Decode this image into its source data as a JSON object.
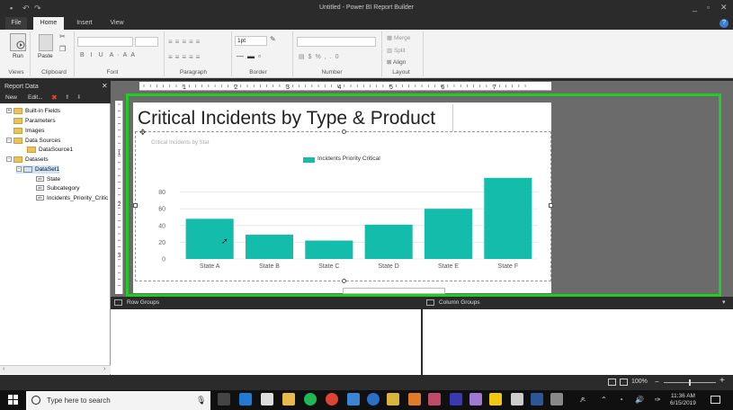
{
  "window": {
    "title": "Untitled - Power BI Report Builder"
  },
  "tabs": [
    {
      "label": "File"
    },
    {
      "label": "Home"
    },
    {
      "label": "Insert"
    },
    {
      "label": "View"
    }
  ],
  "ribbon": {
    "run_label": "Run",
    "paste_label": "Paste",
    "border_size": "1pt",
    "merge_label": "Merge",
    "split_label": "Split",
    "align_label": "Align",
    "groups": {
      "views": "Views",
      "clipboard": "Clipboard",
      "font": "Font",
      "paragraph": "Paragraph",
      "border": "Border",
      "number": "Number",
      "layout": "Layout"
    }
  },
  "report_data": {
    "title": "Report Data",
    "new_label": "New",
    "edit_label": "Edit...",
    "tree": {
      "builtin_fields": "Built-in Fields",
      "parameters": "Parameters",
      "images": "Images",
      "data_sources": "Data Sources",
      "datasource1": "DataSource1",
      "datasets": "Datasets",
      "dataset1": "DataSet1",
      "field_state": "State",
      "field_subcategory": "Subcategory",
      "field_incidents": "Incidents_Priority_Critic"
    }
  },
  "report": {
    "title": "Critical Incidents by Type & Product",
    "chart_subtitle": "Critical Incidents by Stat"
  },
  "ruler_numbers": [
    "1",
    "2",
    "3",
    "4",
    "5",
    "6",
    "7"
  ],
  "ruler_v_numbers": [
    "1",
    "2",
    "3"
  ],
  "chart_data": {
    "type": "bar",
    "categories": [
      "State A",
      "State B",
      "State C",
      "State D",
      "State E",
      "State F"
    ],
    "series": [
      {
        "name": "Incidents Priority Critical",
        "values": [
          48,
          29,
          22,
          41,
          60,
          97
        ],
        "color": "#13bcab"
      }
    ],
    "yticks": [
      0,
      20,
      40,
      60,
      80
    ],
    "ylim": [
      0,
      100
    ],
    "grid": true,
    "legend": "top-center"
  },
  "groups": {
    "row_groups": "Row Groups",
    "column_groups": "Column Groups"
  },
  "status": {
    "zoom": "100%"
  },
  "taskbar": {
    "search_placeholder": "Type here to search",
    "time": "11:36 AM",
    "date": "6/15/2019"
  },
  "colors": {
    "accent_green": "#22cc22",
    "bar": "#13bcab",
    "chrome": "#2b2b2b"
  }
}
